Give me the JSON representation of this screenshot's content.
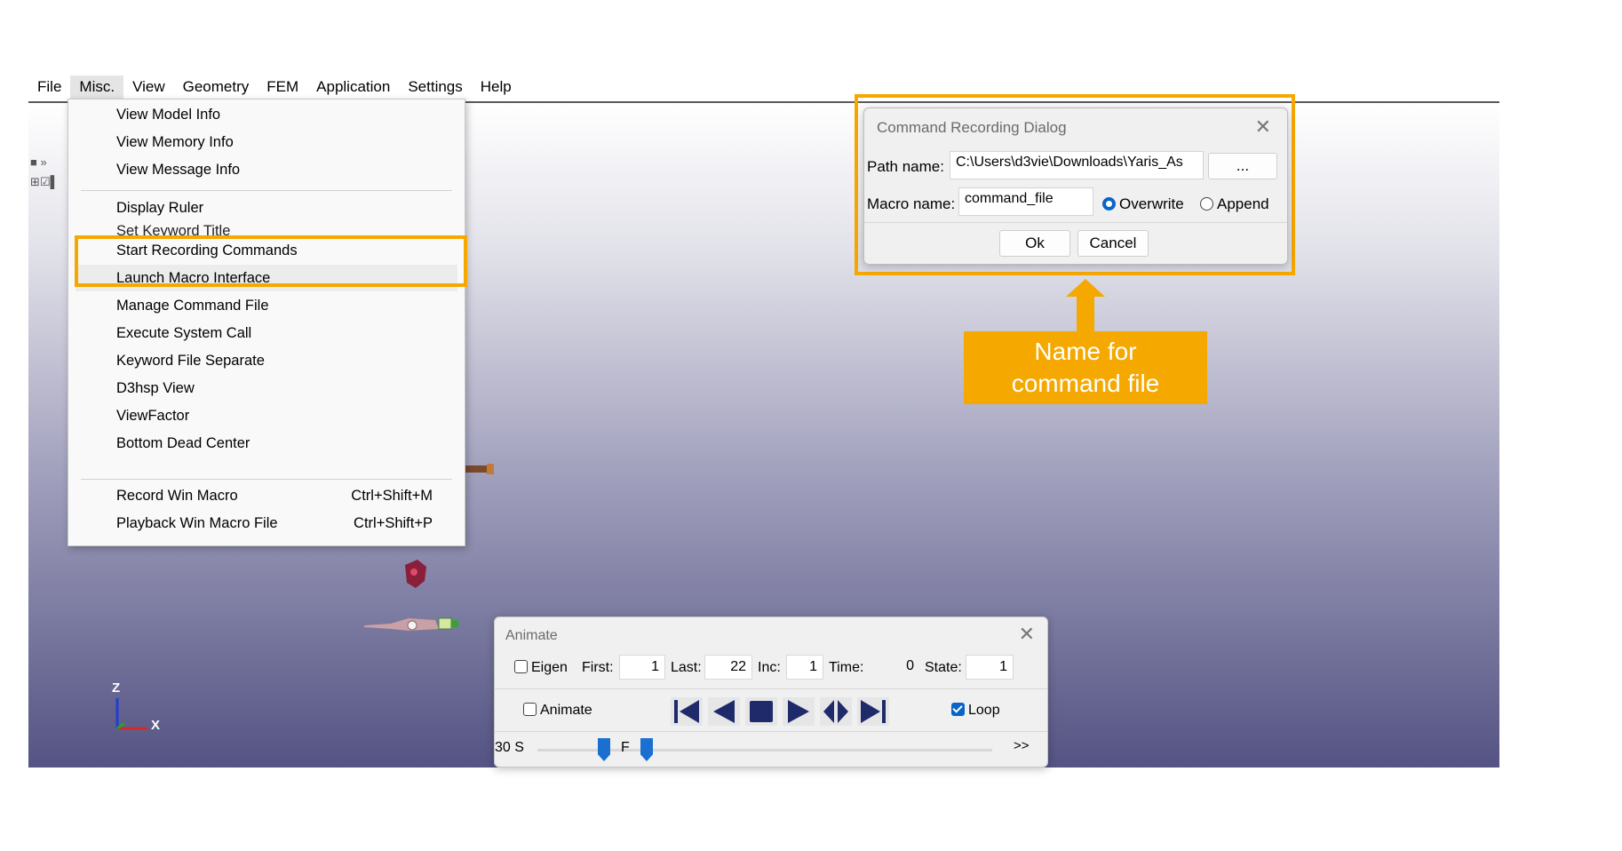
{
  "menubar": [
    "File",
    "Misc.",
    "View",
    "Geometry",
    "FEM",
    "Application",
    "Settings",
    "Help"
  ],
  "misc_menu": {
    "group1": [
      "View Model Info",
      "View Memory Info",
      "View Message Info"
    ],
    "group2": [
      "Display Ruler",
      "Set Keyword Title",
      "Start Recording Commands",
      "Launch Macro Interface",
      "Manage Command File",
      "Execute System Call",
      "Keyword File Separate",
      "D3hsp View",
      "ViewFactor",
      "Bottom Dead Center"
    ],
    "group3": [
      {
        "label": "Record Win Macro",
        "shortcut": "Ctrl+Shift+M"
      },
      {
        "label": "Playback Win Macro File",
        "shortcut": "Ctrl+Shift+P"
      }
    ]
  },
  "dialog": {
    "title": "Command Recording Dialog",
    "path_label": "Path name:",
    "path_value": "C:\\Users\\d3vie\\Downloads\\Yaris_As",
    "browse_label": "...",
    "macro_label": "Macro name:",
    "macro_value": "command_file",
    "overwrite_label": "Overwrite",
    "append_label": "Append",
    "ok_label": "Ok",
    "cancel_label": "Cancel"
  },
  "callout": {
    "line1": "Name for",
    "line2": "command file"
  },
  "animate": {
    "title": "Animate",
    "eigen_label": "Eigen",
    "first_label": "First:",
    "first_value": "1",
    "last_label": "Last:",
    "last_value": "22",
    "inc_label": "Inc:",
    "inc_value": "1",
    "time_label": "Time:",
    "time_value": "0",
    "state_label": "State:",
    "state_value": "1",
    "animate_label": "Animate",
    "loop_label": "Loop",
    "speed_label": "30 S",
    "f_label": "F",
    "more_label": ">>"
  },
  "axes": {
    "z": "Z",
    "x": "X"
  },
  "colors": {
    "accent": "#f5a800",
    "blue": "#0a64c8",
    "playback": "#1f2a6b"
  }
}
